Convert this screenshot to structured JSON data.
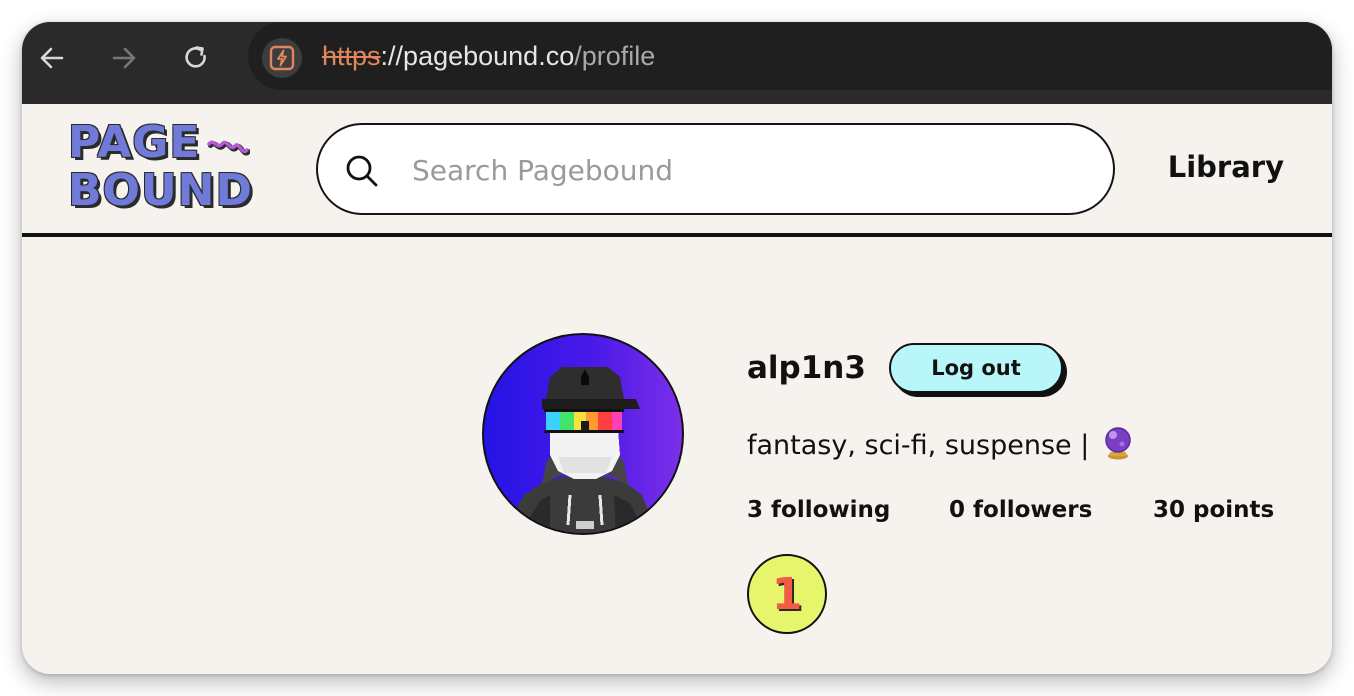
{
  "browser": {
    "url_scheme": "https",
    "url_host": "://pagebound.co",
    "url_path": "/profile"
  },
  "header": {
    "logo_line1": "PAGE",
    "logo_line2": "BOUND",
    "search_placeholder": "Search Pagebound",
    "nav_library": "Library"
  },
  "profile": {
    "username": "alp1n3",
    "logout_label": "Log out",
    "bio": "fantasy, sci-fi, suspense |",
    "stats": {
      "following": "3 following",
      "followers": "0 followers",
      "points": "30 points"
    },
    "badge_number": "1"
  },
  "colors": {
    "page_bg": "#f6f3ee",
    "logo_fill": "#6f7ad9",
    "logout_bg": "#b8f6f9",
    "badge_bg": "#e6f56b",
    "badge_number": "#f25b44",
    "chrome_bg": "#2a2a2a"
  },
  "icons": {
    "back": "arrow-left-icon",
    "forward": "arrow-right-icon",
    "reload": "reload-icon",
    "site": "lightning-icon",
    "search": "search-icon",
    "bio_emoji": "crystal-ball-icon"
  }
}
